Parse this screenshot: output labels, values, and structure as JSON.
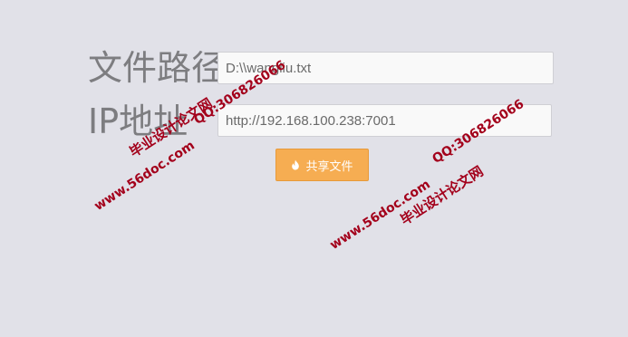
{
  "form": {
    "path_label": "文件路径",
    "path_value": "D:\\\\wangliu.txt",
    "ip_label": "IP地址",
    "ip_value": "http://192.168.100.238:7001",
    "share_label": "共享文件"
  },
  "icons": {
    "share_icon": "fire-icon"
  },
  "colors": {
    "background": "#e1e1e8",
    "button": "#f6ad52",
    "watermark": "#a3001b"
  },
  "watermarks": {
    "site_1": "www.56doc.com",
    "qq_1": "QQ:306826066",
    "cn_1": "毕业设计论文网",
    "site_2": "www.56doc.com",
    "qq_2": "QQ:306826066",
    "cn_2": "毕业设计论文网"
  }
}
